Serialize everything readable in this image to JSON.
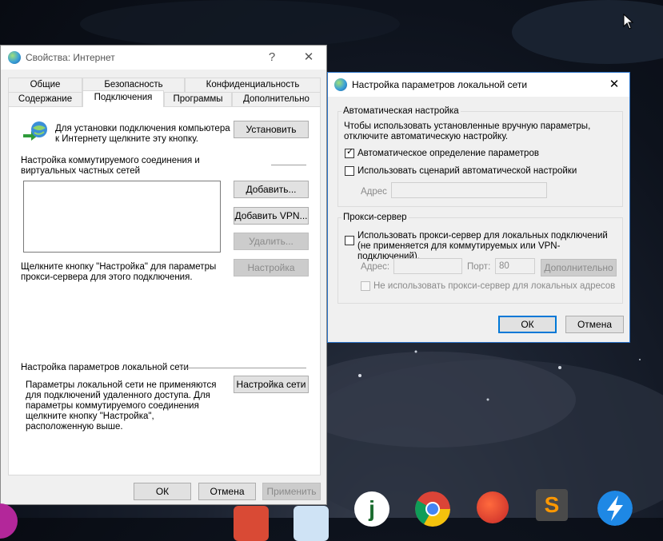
{
  "internet_properties": {
    "title": "Свойства: Интернет",
    "help_glyph": "?",
    "close_glyph": "✕",
    "tabs_row1": [
      "Общие",
      "Безопасность",
      "Конфиденциальность"
    ],
    "tabs_row2": [
      "Содержание",
      "Подключения",
      "Программы",
      "Дополнительно"
    ],
    "setup_text": "Для установки подключения компьютера к Интернету щелкните эту кнопку.",
    "setup_button": "Установить",
    "dialup_label": "Настройка коммутируемого соединения и виртуальных частных сетей",
    "add_button": "Добавить...",
    "add_vpn_button": "Добавить VPN...",
    "remove_button": "Удалить...",
    "settings_button": "Настройка",
    "proxy_hint": "Щелкните кнопку \"Настройка\" для параметры прокси-сервера для этого подключения.",
    "lan_label": "Настройка параметров локальной сети",
    "lan_text": "Параметры локальной сети не применяются для подключений удаленного доступа. Для параметры коммутируемого соединения щелкните кнопку \"Настройка\", расположенную выше.",
    "lan_button": "Настройка сети",
    "ok": "ОК",
    "cancel": "Отмена",
    "apply": "Применить"
  },
  "lan_settings": {
    "title": "Настройка параметров локальной сети",
    "close_glyph": "✕",
    "auto_group": "Автоматическая настройка",
    "auto_desc": "Чтобы использовать установленные вручную параметры, отключите автоматическую настройку.",
    "auto_detect": {
      "label": "Автоматическое определение параметров",
      "checked": true
    },
    "auto_script": {
      "label": "Использовать сценарий автоматической настройки",
      "checked": false
    },
    "address_label": "Адрес",
    "proxy_group": "Прокси-сервер",
    "use_proxy": {
      "label": "Использовать прокси-сервер для локальных подключений (не применяется для коммутируемых или VPN-подключений).",
      "checked": false
    },
    "proxy_address_label": "Адрес:",
    "port_label": "Порт:",
    "port_value": "80",
    "advanced_button": "Дополнительно",
    "bypass_local": {
      "label": "Не использовать прокси-сервер для локальных адресов",
      "checked": false
    },
    "ok": "ОК",
    "cancel": "Отмена",
    "check_mark": "✓"
  },
  "taskbar": {
    "icons": [
      "podcast-icon",
      "app-red-icon",
      "app-star-icon",
      "jdownloader-icon",
      "chrome-icon",
      "ccleaner-icon",
      "sublime-text-icon",
      "thunder-icon"
    ],
    "sublime_letter": "S",
    "j_letter": "j"
  },
  "colors": {
    "accent": "#0078d7",
    "window_bg": "#f0f0f0",
    "disabled_text": "#8a8a8a"
  }
}
